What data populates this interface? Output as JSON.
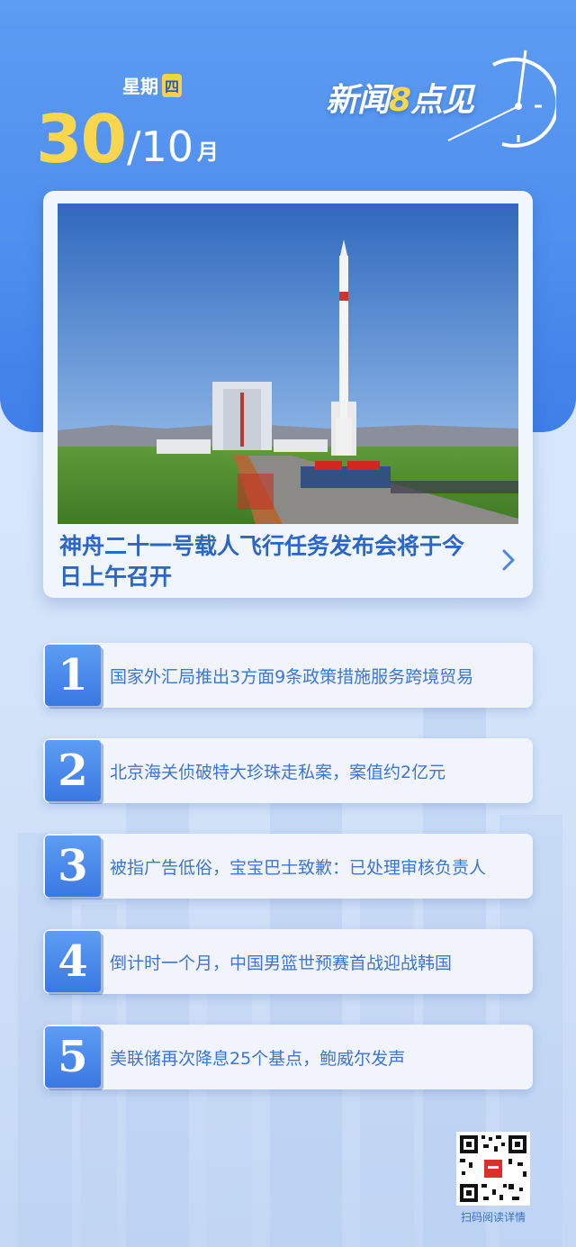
{
  "header": {
    "weekday_prefix": "星期",
    "weekday_day": "四",
    "date_day": "30",
    "date_month": "/10",
    "date_unit": "月",
    "brand_a": "新闻",
    "brand_num": "8",
    "brand_b": "点见"
  },
  "hero": {
    "title": "神舟二十一号载人飞行任务发布会将于今日上午召开",
    "arrow_icon": "chevron-right-icon"
  },
  "news": [
    {
      "num": "1",
      "text": "国家外汇局推出3方面9条政策措施服务跨境贸易"
    },
    {
      "num": "2",
      "text": "北京海关侦破特大珍珠走私案，案值约2亿元"
    },
    {
      "num": "3",
      "text": "被指广告低俗，宝宝巴士致歉：已处理审核负责人"
    },
    {
      "num": "4",
      "text": "倒计时一个月，中国男篮世预赛首战迎战韩国"
    },
    {
      "num": "5",
      "text": "美联储再次降息25个基点，鲍威尔发声"
    }
  ],
  "footer": {
    "qr_caption": "扫码阅读详情"
  },
  "colors": {
    "accent_blue": "#4f8fee",
    "accent_yellow": "#f8d64e",
    "text_blue": "#2b66c9"
  }
}
